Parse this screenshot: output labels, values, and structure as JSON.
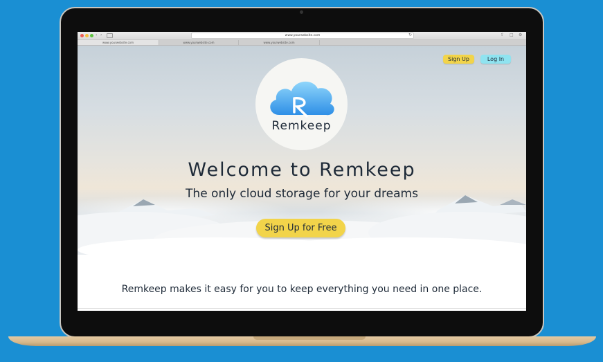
{
  "browser": {
    "url": "www.yourwebsite.com",
    "tabs": [
      "www.yourwebsite.com",
      "www.yourwebsite.com",
      "www.yourwebsite.com"
    ]
  },
  "nav": {
    "signup_label": "Sign Up",
    "login_label": "Log In"
  },
  "logo": {
    "name": "Remkeep",
    "icon": "cloud-r-icon"
  },
  "hero": {
    "title": "Welcome to Remkeep",
    "tagline": "The only cloud storage for your dreams",
    "cta_label": "Sign Up for Free"
  },
  "content": {
    "description": "Remkeep makes it easy for you to keep everything you need in one place."
  },
  "colors": {
    "background": "#1a8fd3",
    "accent_yellow": "#f2d44a",
    "accent_cyan": "#8fe3f0",
    "text": "#1e2a38"
  }
}
